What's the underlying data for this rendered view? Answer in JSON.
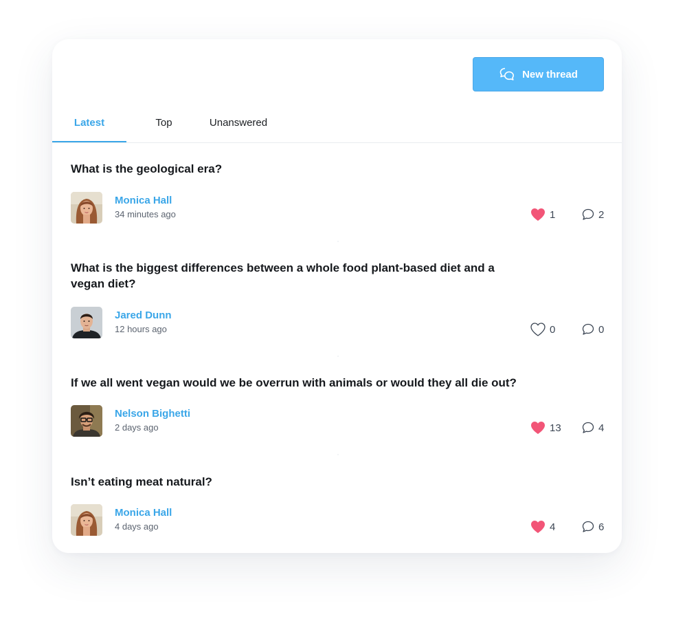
{
  "header": {
    "new_thread_label": "New thread",
    "new_thread_icon": "chat-bubbles-icon",
    "accent_color": "#55b8f9"
  },
  "tabs": [
    {
      "label": "Latest",
      "active": true
    },
    {
      "label": "Top",
      "active": false
    },
    {
      "label": "Unanswered",
      "active": false
    }
  ],
  "threads": [
    {
      "title": "What is the geological era?",
      "author": "Monica Hall",
      "time": "34 minutes ago",
      "avatar": "woman-avatar",
      "likes": "1",
      "liked": true,
      "comments": "2"
    },
    {
      "title": "What is the biggest differences between a whole food plant-based diet and a vegan diet?",
      "author": "Jared Dunn",
      "time": "12 hours ago",
      "avatar": "man-avatar",
      "likes": "0",
      "liked": false,
      "comments": "0"
    },
    {
      "title": "If we all went vegan would we be overrun with animals or would they all die out?",
      "author": "Nelson Bighetti",
      "time": "2 days ago",
      "avatar": "man-glasses-avatar",
      "likes": "13",
      "liked": true,
      "comments": "4"
    },
    {
      "title": "Isn’t eating meat natural?",
      "author": "Monica Hall",
      "time": "4 days ago",
      "avatar": "woman-avatar",
      "likes": "4",
      "liked": true,
      "comments": "6"
    }
  ],
  "colors": {
    "heart": "#f25577",
    "link": "#3aa6e8"
  }
}
